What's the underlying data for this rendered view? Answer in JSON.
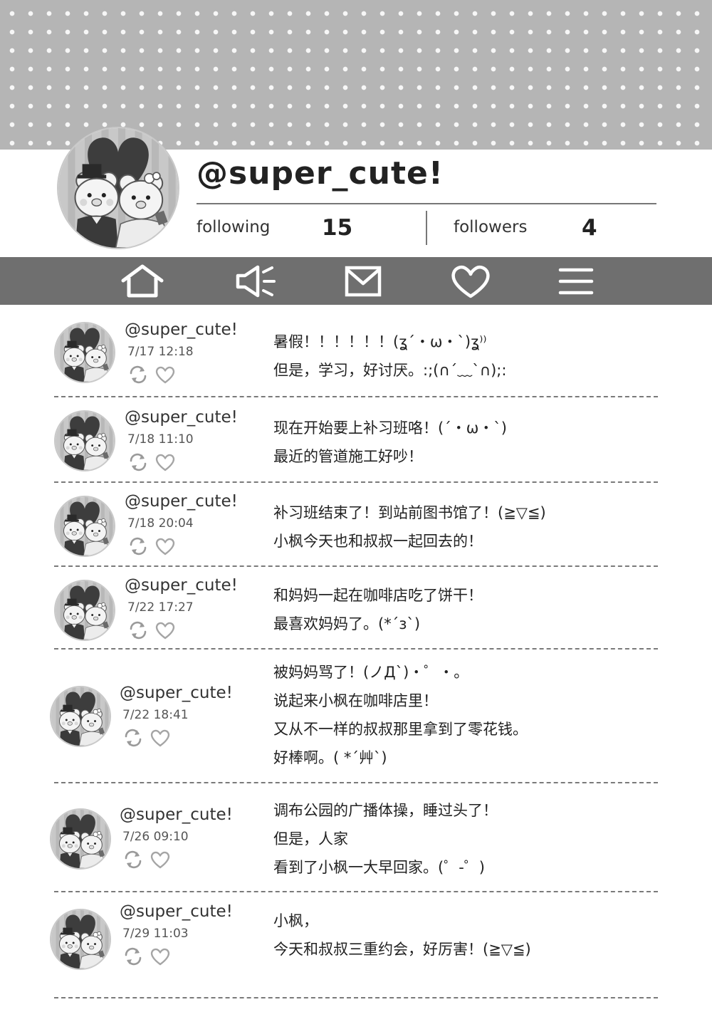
{
  "profile": {
    "handle": "@super_cute!",
    "following_label": "following",
    "following_count": "15",
    "followers_label": "followers",
    "followers_count": "4"
  },
  "nav": [
    {
      "name": "home",
      "icon": "home-icon"
    },
    {
      "name": "announce",
      "icon": "megaphone-icon"
    },
    {
      "name": "messages",
      "icon": "mail-icon"
    },
    {
      "name": "likes",
      "icon": "heart-icon"
    },
    {
      "name": "menu",
      "icon": "menu-icon"
    }
  ],
  "posts": [
    {
      "handle": "@super_cute!",
      "time": "7/17 12:18",
      "lines": [
        "暑假！！！！！！(ʓ´・ω・`)ʓ⁾⁾",
        "但是，学习，好讨厌。:;(∩´﹏`∩);:"
      ]
    },
    {
      "handle": "@super_cute!",
      "time": "7/18 11:10",
      "lines": [
        "现在开始要上补习班咯！(´・ω・`)",
        "最近的管道施工好吵！"
      ]
    },
    {
      "handle": "@super_cute!",
      "time": "7/18 20:04",
      "lines": [
        "补习班结束了！到站前图书馆了！(≧▽≦)",
        "小枫今天也和叔叔一起回去的！"
      ]
    },
    {
      "handle": "@super_cute!",
      "time": "7/22 17:27",
      "lines": [
        "和妈妈一起在咖啡店吃了饼干！",
        "最喜欢妈妈了。(*´з`)"
      ]
    },
    {
      "handle": "@super_cute!",
      "time": "7/22 18:41",
      "lines": [
        "被妈妈骂了！(ノД`)・゜・。",
        "说起来小枫在咖啡店里！",
        "又从不一样的叔叔那里拿到了零花钱。",
        "好棒啊。( *´艸`)"
      ]
    },
    {
      "handle": "@super_cute!",
      "time": "7/26 09:10",
      "lines": [
        "调布公园的广播体操，睡过头了！",
        "但是，人家",
        "看到了小枫一大早回家。(゜-゜)"
      ]
    },
    {
      "handle": "@super_cute!",
      "time": "7/29 11:03",
      "lines": [
        "小枫，",
        "今天和叔叔三重约会，好厉害！(≧▽≦)"
      ]
    }
  ]
}
